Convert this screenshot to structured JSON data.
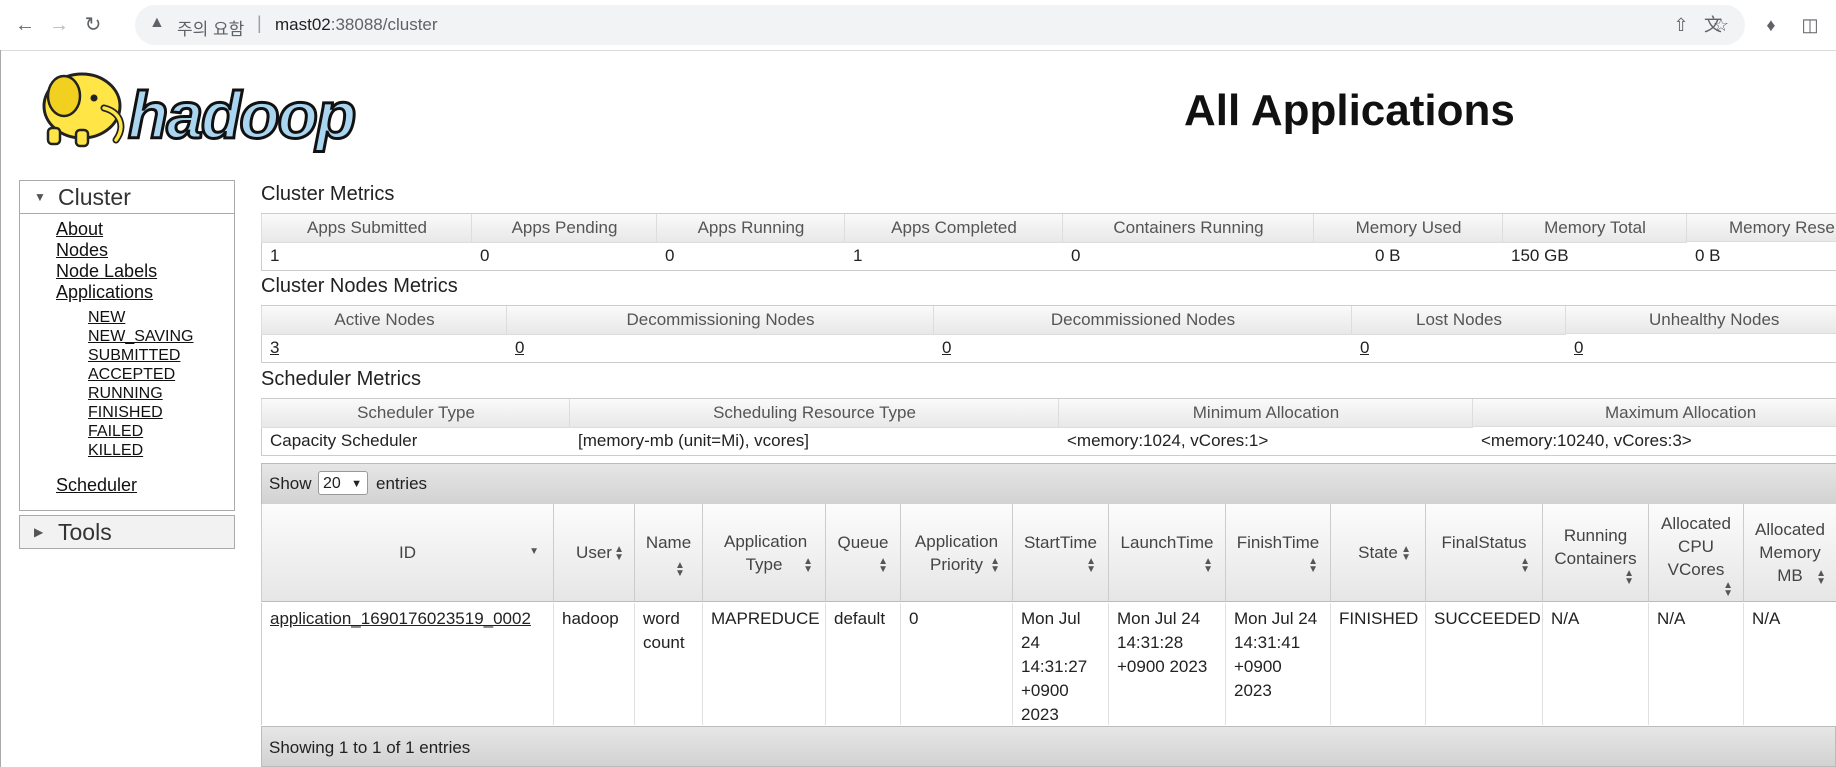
{
  "browser": {
    "security_label": "주의 요함",
    "url_host": "mast02",
    "url_rest": ":38088/cluster",
    "separator": "|"
  },
  "header": {
    "logo_text": "hadoop",
    "page_title": "All Applications"
  },
  "sidebar": {
    "cluster_label": "Cluster",
    "links": [
      "About",
      "Nodes",
      "Node Labels",
      "Applications"
    ],
    "app_states": [
      "NEW",
      "NEW_SAVING",
      "SUBMITTED",
      "ACCEPTED",
      "RUNNING",
      "FINISHED",
      "FAILED",
      "KILLED"
    ],
    "scheduler_label": "Scheduler",
    "tools_label": "Tools"
  },
  "cluster_metrics": {
    "title": "Cluster Metrics",
    "headers": [
      "Apps Submitted",
      "Apps Pending",
      "Apps Running",
      "Apps Completed",
      "Containers Running",
      "Memory Used",
      "Memory Total",
      "Memory Rese"
    ],
    "values": [
      "1",
      "0",
      "0",
      "1",
      "0",
      "0 B",
      "150 GB",
      "0 B"
    ]
  },
  "node_metrics": {
    "title": "Cluster Nodes Metrics",
    "headers": [
      "Active Nodes",
      "Decommissioning Nodes",
      "Decommissioned Nodes",
      "Lost Nodes",
      "Unhealthy Nodes"
    ],
    "values": [
      "3",
      "0",
      "0",
      "0",
      "0"
    ]
  },
  "scheduler_metrics": {
    "title": "Scheduler Metrics",
    "headers": [
      "Scheduler Type",
      "Scheduling Resource Type",
      "Minimum Allocation",
      "Maximum Allocation"
    ],
    "values": [
      "Capacity Scheduler",
      "[memory-mb (unit=Mi), vcores]",
      "<memory:1024, vCores:1>",
      "<memory:10240, vCores:3>"
    ]
  },
  "apps_table": {
    "show_label": "Show",
    "entries_value": "20",
    "entries_label": "entries",
    "columns": [
      "ID",
      "User",
      "Name",
      "Application Type",
      "Queue",
      "Application Priority",
      "StartTime",
      "LaunchTime",
      "FinishTime",
      "State",
      "FinalStatus",
      "Running Containers",
      "Allocated CPU VCores",
      "Allocated Memory MB"
    ],
    "rows": [
      [
        "application_1690176023519_0002",
        "hadoop",
        "word count",
        "MAPREDUCE",
        "default",
        "0",
        "Mon Jul 24 14:31:27 +0900 2023",
        "Mon Jul 24 14:31:28 +0900 2023",
        "Mon Jul 24 14:31:41 +0900 2023",
        "FINISHED",
        "SUCCEEDED",
        "N/A",
        "N/A",
        "N/A"
      ]
    ],
    "footer": "Showing 1 to 1 of 1 entries"
  }
}
